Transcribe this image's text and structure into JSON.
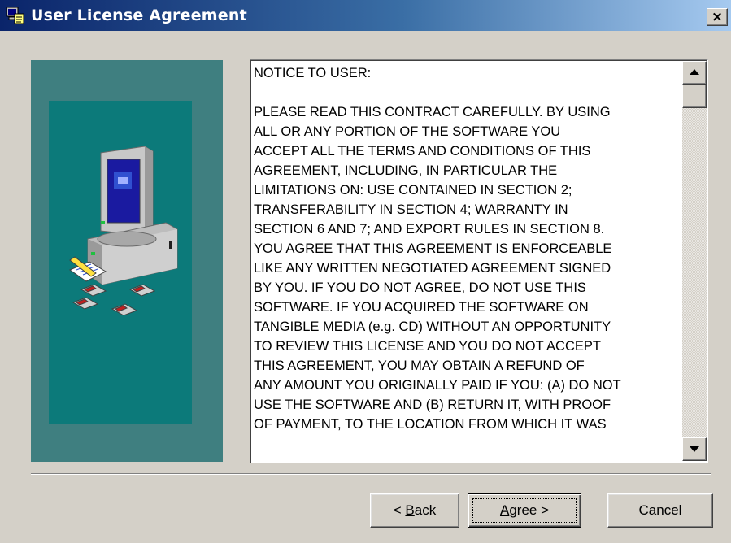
{
  "window": {
    "title": "User License Agreement",
    "close_label": "×",
    "icon": "setup-computer-icon"
  },
  "art_panel": {
    "icon": "computer-with-floppy-disks-illustration",
    "colors": {
      "outer": "#3f7f80",
      "inner": "#0c7a7a"
    }
  },
  "license": {
    "lines": [
      "NOTICE TO USER:",
      "",
      "PLEASE READ THIS CONTRACT CAREFULLY. BY USING",
      "ALL OR ANY PORTION OF THE SOFTWARE YOU",
      "ACCEPT ALL THE TERMS AND CONDITIONS OF THIS",
      "AGREEMENT, INCLUDING, IN PARTICULAR THE",
      "LIMITATIONS ON: USE CONTAINED IN SECTION 2;",
      "TRANSFERABILITY IN SECTION 4; WARRANTY IN",
      "SECTION 6 AND 7; AND EXPORT RULES IN SECTION 8.",
      "YOU AGREE THAT THIS AGREEMENT IS ENFORCEABLE",
      "LIKE ANY WRITTEN NEGOTIATED AGREEMENT SIGNED",
      "BY YOU. IF YOU DO NOT AGREE, DO NOT USE THIS",
      "SOFTWARE. IF YOU ACQUIRED THE SOFTWARE ON",
      "TANGIBLE MEDIA (e.g. CD) WITHOUT AN OPPORTUNITY",
      "TO REVIEW THIS LICENSE AND YOU DO NOT ACCEPT",
      "THIS AGREEMENT, YOU MAY OBTAIN A REFUND OF",
      "ANY AMOUNT YOU ORIGINALLY PAID IF YOU: (A) DO NOT",
      "USE THE SOFTWARE AND (B) RETURN IT, WITH PROOF",
      "OF PAYMENT, TO THE LOCATION FROM WHICH IT WAS"
    ]
  },
  "buttons": {
    "back": {
      "mnemonic_prefix": "< ",
      "mnemonic": "B",
      "rest": "ack"
    },
    "agree": {
      "mnemonic": "A",
      "rest": "gree >"
    },
    "cancel": {
      "label": "Cancel"
    }
  }
}
